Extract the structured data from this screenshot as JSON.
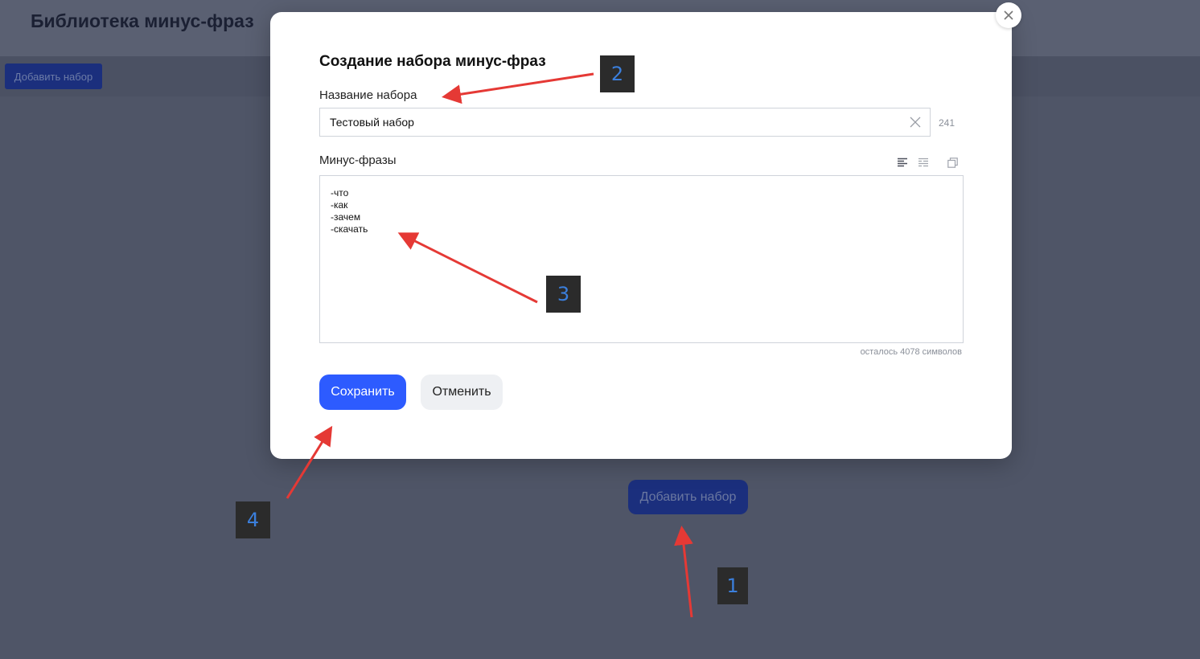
{
  "background": {
    "page_title": "Библиотека минус-фраз",
    "add_set_toolbar_label": "Добавить набор",
    "add_set_center_label": "Добавить набор"
  },
  "modal": {
    "title": "Создание набора минус-фраз",
    "name_field": {
      "label": "Название набора",
      "value": "Тестовый набор",
      "char_count": "241"
    },
    "phrases_field": {
      "label": "Минус-фразы",
      "value": "-что\n-как\n-зачем\n-скачать",
      "remaining_text": "осталось 4078 символов",
      "format_icons": [
        "align-left-icon",
        "list-format-icon",
        "copy-icon"
      ]
    },
    "buttons": {
      "save": "Сохранить",
      "cancel": "Отменить"
    }
  },
  "annotations": {
    "steps": [
      "1",
      "2",
      "3",
      "4"
    ],
    "arrow_color": "#e53935",
    "badge_text_color": "#3b7fdc"
  },
  "colors": {
    "primary_button": "#2d5bff",
    "overlay_background": "#4f5567"
  }
}
